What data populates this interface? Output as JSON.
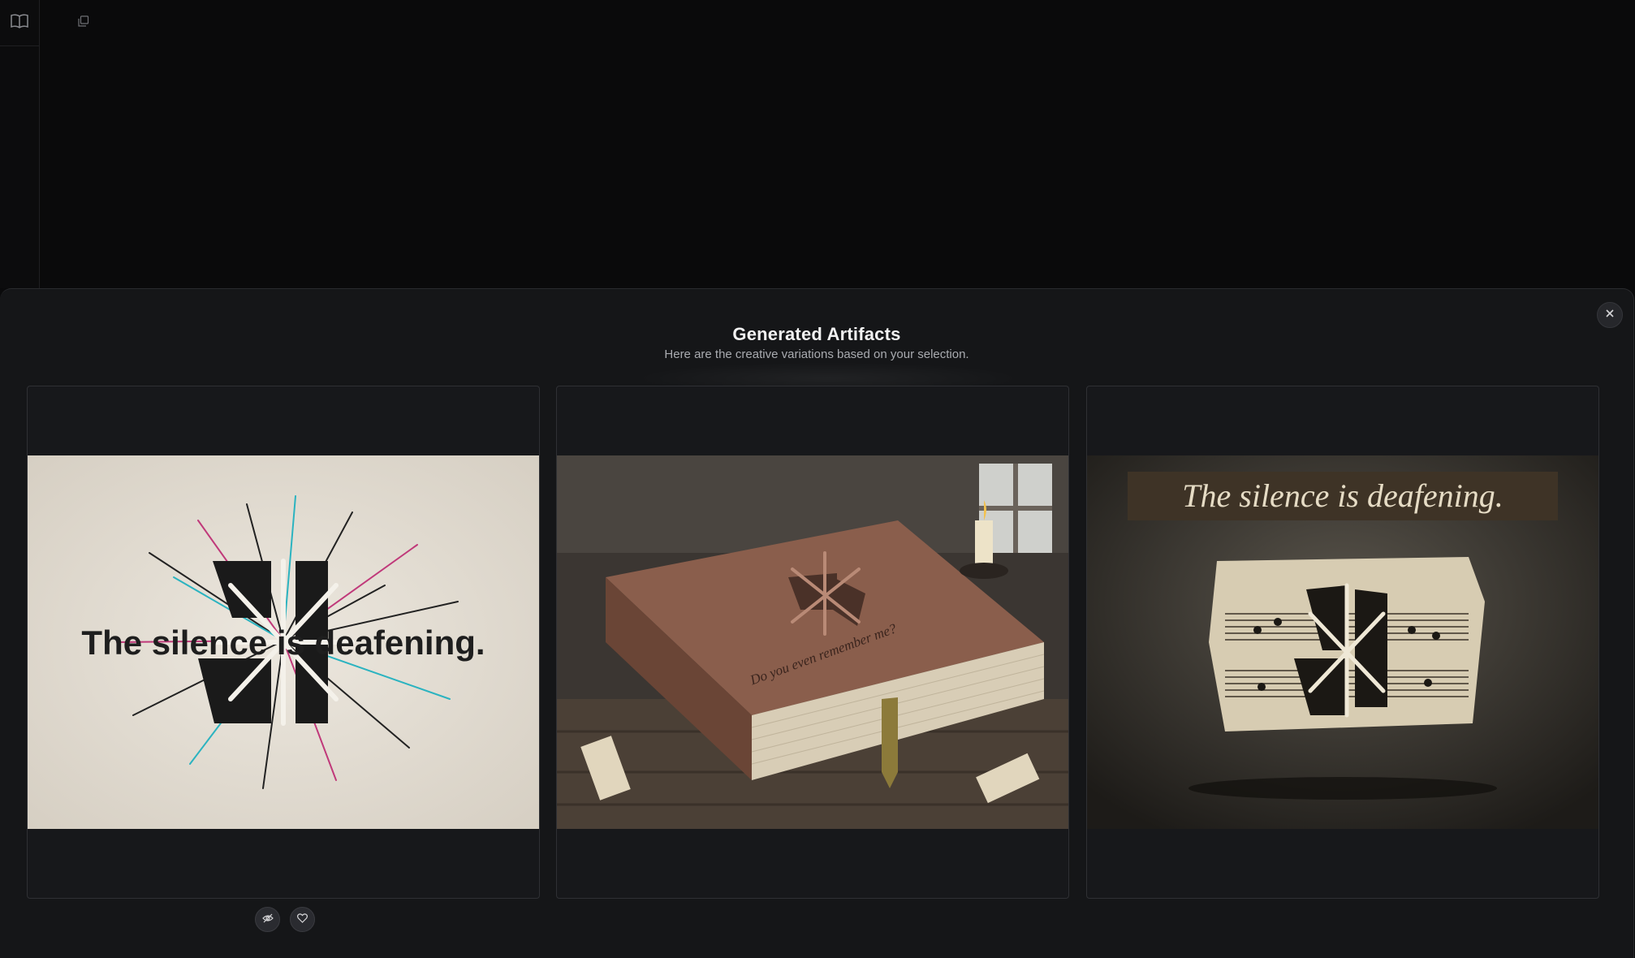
{
  "modal": {
    "title": "Generated Artifacts",
    "subtitle": "Here are the creative variations based on your selection."
  },
  "cards": [
    {
      "image_text": "The silence is deafening."
    },
    {
      "image_text": "Do you even remember me?"
    },
    {
      "image_text": "The silence is deafening."
    }
  ],
  "icons": {
    "sidebar": "book-open-icon",
    "toolbar": "copy-icon",
    "close": "close-icon",
    "hide": "eye-off-icon",
    "favorite": "heart-icon"
  },
  "colors": {
    "background": "#0a0a0b",
    "panel": "#151618",
    "card": "#17181b",
    "text_primary": "#f2f2f2",
    "text_secondary": "#a9abb0"
  }
}
